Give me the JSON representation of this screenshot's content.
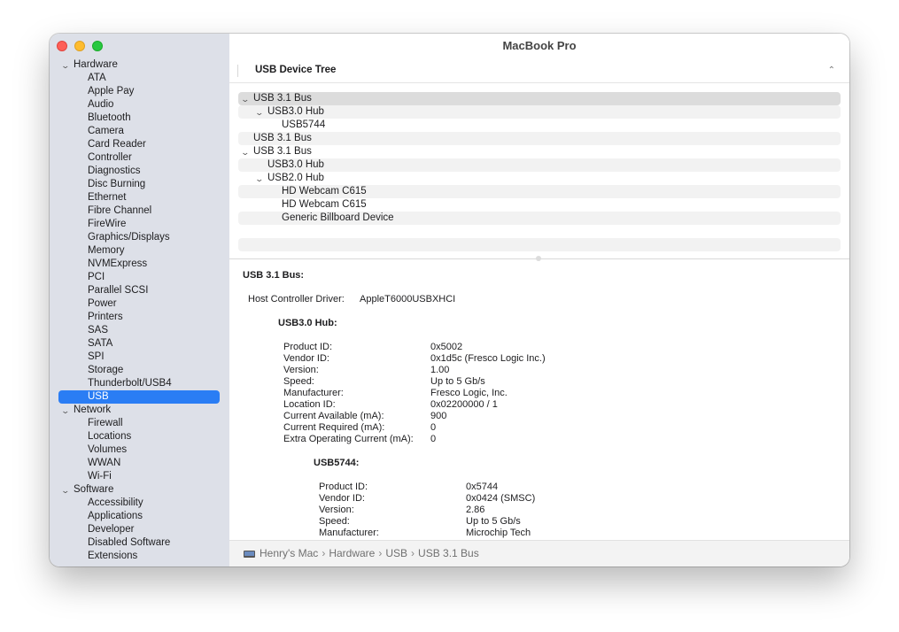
{
  "window": {
    "title": "MacBook Pro"
  },
  "sidebar": {
    "hardware_label": "Hardware",
    "hardware_items": [
      "ATA",
      "Apple Pay",
      "Audio",
      "Bluetooth",
      "Camera",
      "Card Reader",
      "Controller",
      "Diagnostics",
      "Disc Burning",
      "Ethernet",
      "Fibre Channel",
      "FireWire",
      "Graphics/Displays",
      "Memory",
      "NVMExpress",
      "PCI",
      "Parallel SCSI",
      "Power",
      "Printers",
      "SAS",
      "SATA",
      "SPI",
      "Storage",
      "Thunderbolt/USB4",
      "USB"
    ],
    "selected_item": "USB",
    "network_label": "Network",
    "network_items": [
      "Firewall",
      "Locations",
      "Volumes",
      "WWAN",
      "Wi-Fi"
    ],
    "software_label": "Software",
    "software_items": [
      "Accessibility",
      "Applications",
      "Developer",
      "Disabled Software",
      "Extensions"
    ]
  },
  "section": {
    "title": "USB Device Tree"
  },
  "device_tree": [
    "USB 3.1 Bus",
    "USB3.0 Hub",
    "USB5744",
    "USB 3.1 Bus",
    "USB 3.1 Bus",
    "USB3.0 Hub",
    "USB2.0 Hub",
    "HD Webcam C615",
    "HD Webcam C615",
    "Generic Billboard Device"
  ],
  "detail": {
    "bus_title": "USB 3.1 Bus:",
    "host_label": "Host Controller Driver:",
    "host_value": "AppleT6000USBXHCI",
    "hub_title": "USB3.0 Hub:",
    "hub_props": [
      {
        "k": "Product ID:",
        "v": "0x5002"
      },
      {
        "k": "Vendor ID:",
        "v": "0x1d5c  (Fresco Logic Inc.)"
      },
      {
        "k": "Version:",
        "v": "1.00"
      },
      {
        "k": "Speed:",
        "v": "Up to 5 Gb/s"
      },
      {
        "k": "Manufacturer:",
        "v": "Fresco Logic, Inc."
      },
      {
        "k": "Location ID:",
        "v": "0x02200000 / 1"
      },
      {
        "k": "Current Available (mA):",
        "v": "900"
      },
      {
        "k": "Current Required (mA):",
        "v": "0"
      },
      {
        "k": "Extra Operating Current (mA):",
        "v": "0"
      }
    ],
    "dev_title": "USB5744:",
    "dev_props": [
      {
        "k": "Product ID:",
        "v": "0x5744"
      },
      {
        "k": "Vendor ID:",
        "v": "0x0424  (SMSC)"
      },
      {
        "k": "Version:",
        "v": "2.86"
      },
      {
        "k": "Speed:",
        "v": "Up to 5 Gb/s"
      },
      {
        "k": "Manufacturer:",
        "v": "Microchip Tech"
      }
    ]
  },
  "breadcrumb": [
    "Henry's Mac",
    "Hardware",
    "USB",
    "USB 3.1 Bus"
  ]
}
